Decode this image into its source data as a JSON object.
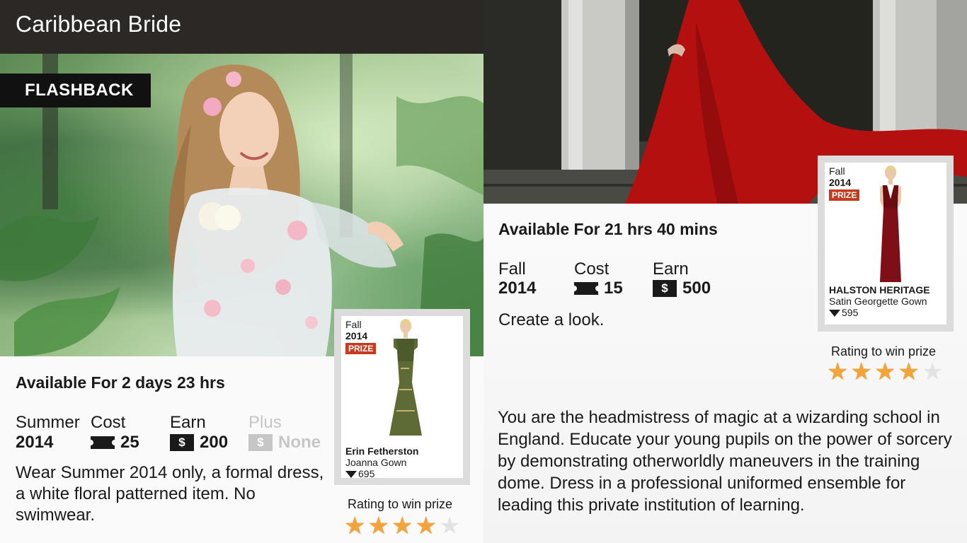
{
  "left": {
    "title": "Caribbean Bride",
    "badge": "FLASHBACK",
    "availability": "Available For 2 days 23 hrs",
    "stats": {
      "season_label": "Summer",
      "season_year": "2014",
      "cost_label": "Cost",
      "cost_value": "25",
      "earn_label": "Earn",
      "earn_value": "200",
      "plus_label": "Plus",
      "plus_value": "None",
      "dollar_symbol": "$"
    },
    "description": "Wear Summer 2014 only, a formal dress, a white floral patterned item. No swimwear.",
    "prize": {
      "season": "Fall",
      "year": "2014",
      "badge": "PRIZE",
      "brand": "Erin Fetherston",
      "item": "Joanna Gown",
      "gems": "695",
      "rating_label": "Rating to win prize",
      "stars_filled": 4,
      "stars_total": 5
    }
  },
  "right": {
    "availability": "Available For 21 hrs 40 mins",
    "stats": {
      "season_label": "Fall",
      "season_year": "2014",
      "cost_label": "Cost",
      "cost_value": "15",
      "earn_label": "Earn",
      "earn_value": "500",
      "dollar_symbol": "$"
    },
    "short_desc": "Create a look.",
    "description": "You are the headmistress of magic at a wizarding school in England. Educate your young pupils on the power of sorcery by demonstrating otherworldly maneuvers in the training dome. Dress in a professional uniformed ensemble for leading this private institution of learning.",
    "prize": {
      "season": "Fall",
      "year": "2014",
      "badge": "PRIZE",
      "brand": "HALSTON HERITAGE",
      "item": "Satin Georgette Gown",
      "gems": "595",
      "rating_label": "Rating to win prize",
      "stars_filled": 4,
      "stars_total": 5
    }
  },
  "colors": {
    "title_bar": "#2b2826",
    "prize_badge": "#c63a1d",
    "star_on": "#f2a43a",
    "star_off": "#e3e3e3"
  }
}
